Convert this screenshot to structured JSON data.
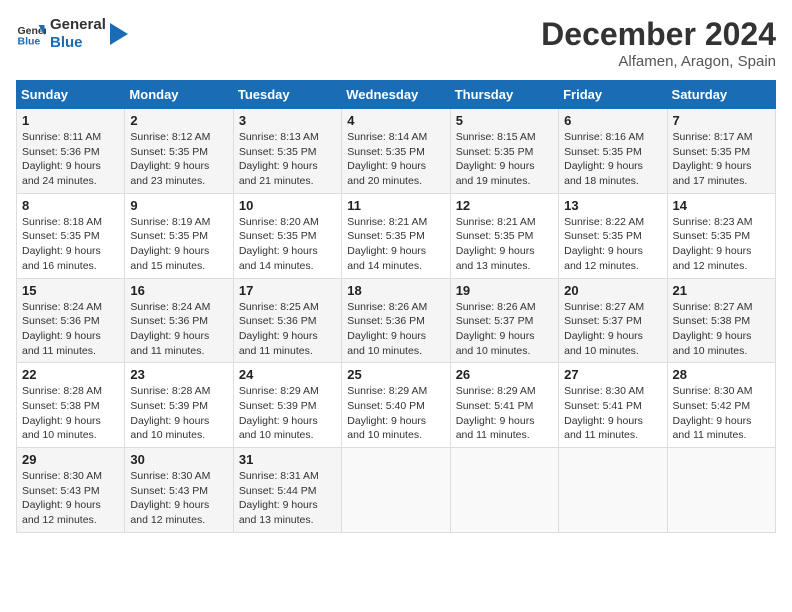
{
  "logo": {
    "line1": "General",
    "line2": "Blue"
  },
  "title": "December 2024",
  "subtitle": "Alfamen, Aragon, Spain",
  "days_of_week": [
    "Sunday",
    "Monday",
    "Tuesday",
    "Wednesday",
    "Thursday",
    "Friday",
    "Saturday"
  ],
  "weeks": [
    [
      {
        "day": "1",
        "sunrise": "8:11 AM",
        "sunset": "5:36 PM",
        "daylight": "9 hours and 24 minutes."
      },
      {
        "day": "2",
        "sunrise": "8:12 AM",
        "sunset": "5:35 PM",
        "daylight": "9 hours and 23 minutes."
      },
      {
        "day": "3",
        "sunrise": "8:13 AM",
        "sunset": "5:35 PM",
        "daylight": "9 hours and 21 minutes."
      },
      {
        "day": "4",
        "sunrise": "8:14 AM",
        "sunset": "5:35 PM",
        "daylight": "9 hours and 20 minutes."
      },
      {
        "day": "5",
        "sunrise": "8:15 AM",
        "sunset": "5:35 PM",
        "daylight": "9 hours and 19 minutes."
      },
      {
        "day": "6",
        "sunrise": "8:16 AM",
        "sunset": "5:35 PM",
        "daylight": "9 hours and 18 minutes."
      },
      {
        "day": "7",
        "sunrise": "8:17 AM",
        "sunset": "5:35 PM",
        "daylight": "9 hours and 17 minutes."
      }
    ],
    [
      {
        "day": "8",
        "sunrise": "8:18 AM",
        "sunset": "5:35 PM",
        "daylight": "9 hours and 16 minutes."
      },
      {
        "day": "9",
        "sunrise": "8:19 AM",
        "sunset": "5:35 PM",
        "daylight": "9 hours and 15 minutes."
      },
      {
        "day": "10",
        "sunrise": "8:20 AM",
        "sunset": "5:35 PM",
        "daylight": "9 hours and 14 minutes."
      },
      {
        "day": "11",
        "sunrise": "8:21 AM",
        "sunset": "5:35 PM",
        "daylight": "9 hours and 14 minutes."
      },
      {
        "day": "12",
        "sunrise": "8:21 AM",
        "sunset": "5:35 PM",
        "daylight": "9 hours and 13 minutes."
      },
      {
        "day": "13",
        "sunrise": "8:22 AM",
        "sunset": "5:35 PM",
        "daylight": "9 hours and 12 minutes."
      },
      {
        "day": "14",
        "sunrise": "8:23 AM",
        "sunset": "5:35 PM",
        "daylight": "9 hours and 12 minutes."
      }
    ],
    [
      {
        "day": "15",
        "sunrise": "8:24 AM",
        "sunset": "5:36 PM",
        "daylight": "9 hours and 11 minutes."
      },
      {
        "day": "16",
        "sunrise": "8:24 AM",
        "sunset": "5:36 PM",
        "daylight": "9 hours and 11 minutes."
      },
      {
        "day": "17",
        "sunrise": "8:25 AM",
        "sunset": "5:36 PM",
        "daylight": "9 hours and 11 minutes."
      },
      {
        "day": "18",
        "sunrise": "8:26 AM",
        "sunset": "5:36 PM",
        "daylight": "9 hours and 10 minutes."
      },
      {
        "day": "19",
        "sunrise": "8:26 AM",
        "sunset": "5:37 PM",
        "daylight": "9 hours and 10 minutes."
      },
      {
        "day": "20",
        "sunrise": "8:27 AM",
        "sunset": "5:37 PM",
        "daylight": "9 hours and 10 minutes."
      },
      {
        "day": "21",
        "sunrise": "8:27 AM",
        "sunset": "5:38 PM",
        "daylight": "9 hours and 10 minutes."
      }
    ],
    [
      {
        "day": "22",
        "sunrise": "8:28 AM",
        "sunset": "5:38 PM",
        "daylight": "9 hours and 10 minutes."
      },
      {
        "day": "23",
        "sunrise": "8:28 AM",
        "sunset": "5:39 PM",
        "daylight": "9 hours and 10 minutes."
      },
      {
        "day": "24",
        "sunrise": "8:29 AM",
        "sunset": "5:39 PM",
        "daylight": "9 hours and 10 minutes."
      },
      {
        "day": "25",
        "sunrise": "8:29 AM",
        "sunset": "5:40 PM",
        "daylight": "9 hours and 10 minutes."
      },
      {
        "day": "26",
        "sunrise": "8:29 AM",
        "sunset": "5:41 PM",
        "daylight": "9 hours and 11 minutes."
      },
      {
        "day": "27",
        "sunrise": "8:30 AM",
        "sunset": "5:41 PM",
        "daylight": "9 hours and 11 minutes."
      },
      {
        "day": "28",
        "sunrise": "8:30 AM",
        "sunset": "5:42 PM",
        "daylight": "9 hours and 11 minutes."
      }
    ],
    [
      {
        "day": "29",
        "sunrise": "8:30 AM",
        "sunset": "5:43 PM",
        "daylight": "9 hours and 12 minutes."
      },
      {
        "day": "30",
        "sunrise": "8:30 AM",
        "sunset": "5:43 PM",
        "daylight": "9 hours and 12 minutes."
      },
      {
        "day": "31",
        "sunrise": "8:31 AM",
        "sunset": "5:44 PM",
        "daylight": "9 hours and 13 minutes."
      },
      null,
      null,
      null,
      null
    ]
  ]
}
